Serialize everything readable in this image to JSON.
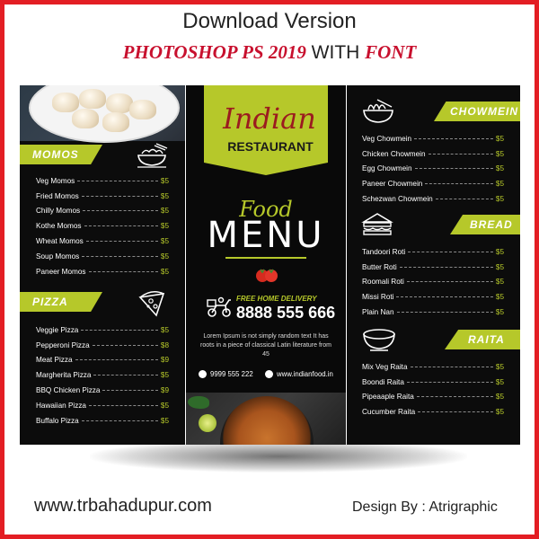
{
  "header": {
    "line1": "Download Version",
    "line2_red1": "PHOTOSHOP PS 2019",
    "line2_plain": " WITH ",
    "line2_red2": "FONT"
  },
  "footer": {
    "website": "www.trbahadupur.com",
    "credit": "Design By : Atrigraphic"
  },
  "colors": {
    "accent": "#b6c82a",
    "panel": "#0c0c0c",
    "frame": "#e31e24",
    "brand_red": "#9b1b1f"
  },
  "brand": {
    "script": "Indian",
    "subtitle": "RESTAURANT"
  },
  "title": {
    "script": "Food",
    "main": "MENU"
  },
  "delivery": {
    "label": "FREE HOME DELIVERY",
    "phone": "8888 555 666"
  },
  "blurb": "Lorem Ipsum is not simply random text It has roots in a piece of classical Latin literature from 45",
  "contact": {
    "phone": "9999 555 222",
    "web": "www.indianfood.in"
  },
  "sections": {
    "momos": {
      "title": "MOMOS",
      "icon": "bowl-icon",
      "items": [
        {
          "name": "Veg Momos",
          "price": "$5"
        },
        {
          "name": "Fried Momos",
          "price": "$5"
        },
        {
          "name": "Chilly Momos",
          "price": "$5"
        },
        {
          "name": "Kothe Momos",
          "price": "$5"
        },
        {
          "name": "Wheat Momos",
          "price": "$5"
        },
        {
          "name": "Soup Momos",
          "price": "$5"
        },
        {
          "name": "Paneer Momos",
          "price": "$5"
        }
      ]
    },
    "pizza": {
      "title": "PIZZA",
      "icon": "pizza-icon",
      "items": [
        {
          "name": "Veggie Pizza",
          "price": "$5"
        },
        {
          "name": "Pepperoni Pizza",
          "price": "$8"
        },
        {
          "name": "Meat Pizza",
          "price": "$9"
        },
        {
          "name": "Margherita Pizza",
          "price": "$5"
        },
        {
          "name": "BBQ Chicken Pizza",
          "price": "$9"
        },
        {
          "name": "Hawaiian Pizza",
          "price": "$5"
        },
        {
          "name": "Buffalo Pizza",
          "price": "$5"
        }
      ]
    },
    "chowmein": {
      "title": "CHOWMEIN",
      "icon": "noodle-bowl-icon",
      "items": [
        {
          "name": "Veg Chowmein",
          "price": "$5"
        },
        {
          "name": "Chicken Chowmein",
          "price": "$5"
        },
        {
          "name": "Egg Chowmein",
          "price": "$5"
        },
        {
          "name": "Paneer Chowmein",
          "price": "$5"
        },
        {
          "name": "Schezwan Chowmein",
          "price": "$5"
        }
      ]
    },
    "bread": {
      "title": "BREAD",
      "icon": "sandwich-icon",
      "items": [
        {
          "name": "Tandoori Roti",
          "price": "$5"
        },
        {
          "name": "Butter Roti",
          "price": "$5"
        },
        {
          "name": "Roomali Roti",
          "price": "$5"
        },
        {
          "name": "Missi Roti",
          "price": "$5"
        },
        {
          "name": "Plain Nan",
          "price": "$5"
        }
      ]
    },
    "raita": {
      "title": "RAITA",
      "icon": "soup-bowl-icon",
      "items": [
        {
          "name": "Mix Veg Raita",
          "price": "$5"
        },
        {
          "name": "Boondi Raita",
          "price": "$5"
        },
        {
          "name": "Pipeaaple Raita",
          "price": "$5"
        },
        {
          "name": "Cucumber Raita",
          "price": "$5"
        }
      ]
    }
  }
}
